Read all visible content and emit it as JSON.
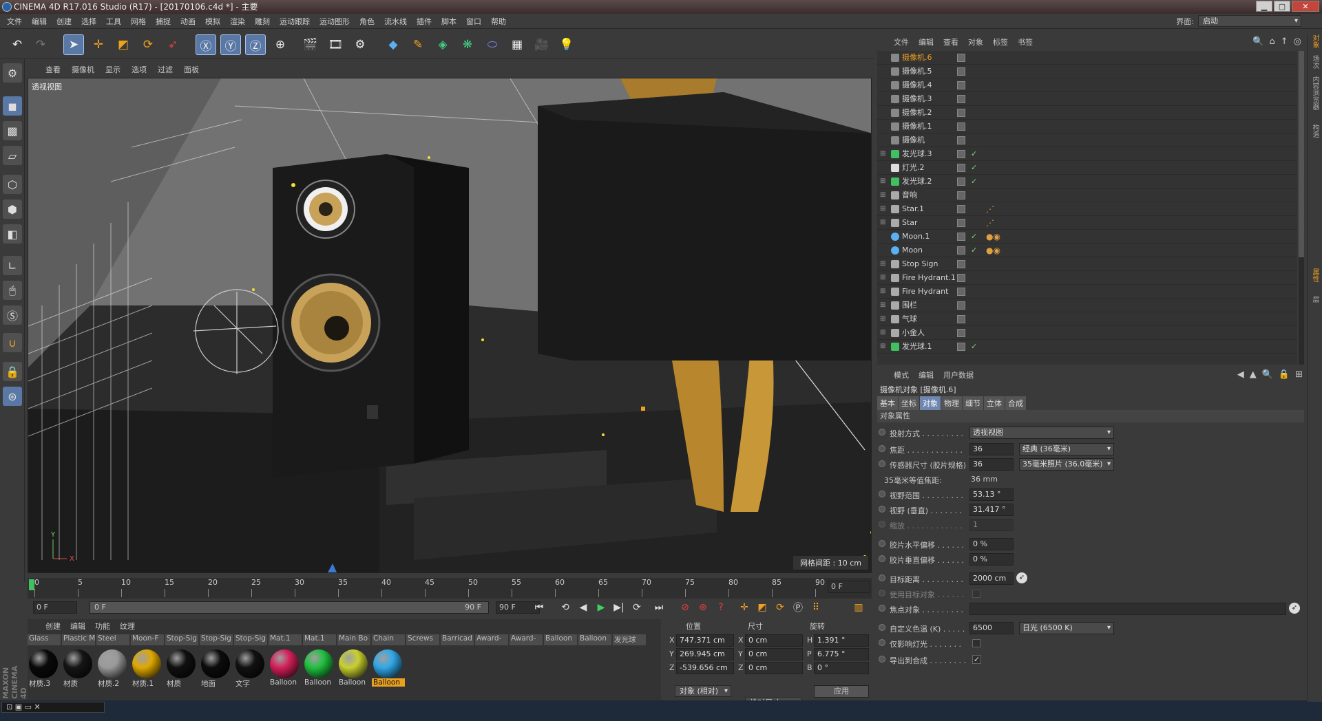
{
  "window": {
    "title": "CINEMA 4D R17.016 Studio (R17) - [20170106.c4d *] - 主要"
  },
  "menu": [
    "文件",
    "编辑",
    "创建",
    "选择",
    "工具",
    "网格",
    "捕捉",
    "动画",
    "模拟",
    "渲染",
    "雕刻",
    "运动跟踪",
    "运动图形",
    "角色",
    "流水线",
    "插件",
    "脚本",
    "窗口",
    "帮助"
  ],
  "interface": {
    "label": "界面:",
    "value": "启动"
  },
  "viewport": {
    "menu": [
      "查看",
      "摄像机",
      "显示",
      "选项",
      "过滤",
      "面板"
    ],
    "label": "透视视图",
    "grid_info": "网格间距 : 10 cm"
  },
  "timeline": {
    "ticks": [
      "0",
      "5",
      "10",
      "15",
      "20",
      "25",
      "30",
      "35",
      "40",
      "45",
      "50",
      "55",
      "60",
      "65",
      "70",
      "75",
      "80",
      "85",
      "90"
    ],
    "frame_right": "0 F",
    "start": "0 F",
    "range_start": "0 F",
    "range_end": "90 F",
    "end": "90 F"
  },
  "materials": {
    "menu": [
      "创建",
      "编辑",
      "功能",
      "纹理"
    ],
    "top_labels": [
      "Glass",
      "Plastic M",
      "Steel",
      "Moon-F",
      "Stop-Sig",
      "Stop-Sig",
      "Stop-Sig",
      "Mat.1",
      "Mat.1",
      "Main Bo",
      "Chain",
      "Screws",
      "Barricad",
      "Award-",
      "Award-",
      "Balloon",
      "Balloon",
      "发光球"
    ],
    "items": [
      {
        "name": "材质.3",
        "color": "#0a0a0a"
      },
      {
        "name": "材质",
        "color": "#151515"
      },
      {
        "name": "材质.2",
        "color": "#9a9a9a"
      },
      {
        "name": "材质.1",
        "color": "#e0a800"
      },
      {
        "name": "材质",
        "color": "#101010"
      },
      {
        "name": "地面",
        "color": "#0c0c0c"
      },
      {
        "name": "文字",
        "color": "#111111"
      },
      {
        "name": "Balloon",
        "color": "#d4205a"
      },
      {
        "name": "Balloon",
        "color": "#20c040"
      },
      {
        "name": "Balloon",
        "color": "#c8d030"
      },
      {
        "name": "Balloon",
        "color": "#30a8e8",
        "highlight": true
      }
    ]
  },
  "coords": {
    "headers": [
      "位置",
      "尺寸",
      "旋转"
    ],
    "rows": [
      {
        "axis": "X",
        "pos": "747.371 cm",
        "size_axis": "X",
        "size": "0 cm",
        "rot_axis": "H",
        "rot": "1.391 °"
      },
      {
        "axis": "Y",
        "pos": "269.945 cm",
        "size_axis": "Y",
        "size": "0 cm",
        "rot_axis": "P",
        "rot": "6.775 °"
      },
      {
        "axis": "Z",
        "pos": "-539.656 cm",
        "size_axis": "Z",
        "size": "0 cm",
        "rot_axis": "B",
        "rot": "0 °"
      }
    ],
    "mode1": "对象 (相对)",
    "mode2": "绝对尺寸",
    "apply": "应用"
  },
  "object_manager": {
    "menu": [
      "文件",
      "编辑",
      "查看",
      "对象",
      "标签",
      "书签"
    ],
    "objects": [
      {
        "name": "摄像机.6",
        "type": "camera",
        "selected": true
      },
      {
        "name": "摄像机.5",
        "type": "camera"
      },
      {
        "name": "摄像机.4",
        "type": "camera"
      },
      {
        "name": "摄像机.3",
        "type": "camera"
      },
      {
        "name": "摄像机.2",
        "type": "camera"
      },
      {
        "name": "摄像机.1",
        "type": "camera"
      },
      {
        "name": "摄像机",
        "type": "camera"
      },
      {
        "name": "发光球.3",
        "type": "generator",
        "check": true
      },
      {
        "name": "灯光.2",
        "type": "light",
        "check": true
      },
      {
        "name": "发光球.2",
        "type": "generator",
        "check": true
      },
      {
        "name": "音响",
        "type": "null"
      },
      {
        "name": "Star.1",
        "type": "null",
        "tags": "⋰"
      },
      {
        "name": "Star",
        "type": "null",
        "tags": "⋰"
      },
      {
        "name": "Moon.1",
        "type": "sphere",
        "check": true,
        "tags": "●◉"
      },
      {
        "name": "Moon",
        "type": "sphere",
        "check": true,
        "tags": "●◉"
      },
      {
        "name": "Stop Sign",
        "type": "null"
      },
      {
        "name": "Fire Hydrant.1",
        "type": "null"
      },
      {
        "name": "Fire Hydrant",
        "type": "null"
      },
      {
        "name": "围栏",
        "type": "null"
      },
      {
        "name": "气球",
        "type": "null"
      },
      {
        "name": "小金人",
        "type": "null"
      },
      {
        "name": "发光球.1",
        "type": "generator",
        "check": true
      }
    ]
  },
  "attributes": {
    "menu": [
      "模式",
      "编辑",
      "用户数据"
    ],
    "title": "摄像机对象 [摄像机.6]",
    "tabs": [
      "基本",
      "坐标",
      "对象",
      "物理",
      "细节",
      "立体",
      "合成"
    ],
    "active_tab": "对象",
    "section": "对象属性",
    "projection": {
      "label": "投射方式 . . . . . . . . .",
      "value": "透视视图"
    },
    "focal": {
      "label": "焦距 . . . . . . . . . . . .",
      "value": "36",
      "preset": "经典 (36毫米)"
    },
    "sensor": {
      "label": "传感器尺寸 (胶片规格)",
      "value": "36",
      "preset": "35毫米照片 (36.0毫米)"
    },
    "equiv": {
      "label": "35毫米等值焦距:",
      "value": "36 mm"
    },
    "fov": {
      "label": "视野范围 . . . . . . . . .",
      "value": "53.13 °"
    },
    "fov_v": {
      "label": "视野 (垂直) . . . . . . .",
      "value": "31.417 °"
    },
    "zoom": {
      "label": "缩放 . . . . . . . . . . . .",
      "value": "1"
    },
    "film_h": {
      "label": "胶片水平偏移 . . . . . .",
      "value": "0 %"
    },
    "film_v": {
      "label": "胶片垂直偏移 . . . . . .",
      "value": "0 %"
    },
    "target_dist": {
      "label": "目标距离 . . . . . . . . .",
      "value": "2000 cm"
    },
    "use_target": {
      "label": "使用目标对象 . . . . . ."
    },
    "focus_obj": {
      "label": "焦点对象 . . . . . . . . ."
    },
    "color_temp": {
      "label": "自定义色温 (K) . . . . .",
      "value": "6500",
      "preset": "日光 (6500 K)"
    },
    "affect_light": {
      "label": "仅影响灯光 . . . . . . ."
    },
    "export": {
      "label": "导出到合成 . . . . . . . ."
    }
  },
  "right_strip": [
    "对象",
    "场次",
    "内容浏览器",
    "构造",
    "属性",
    "层"
  ],
  "brand": "MAXON CINEMA 4D"
}
